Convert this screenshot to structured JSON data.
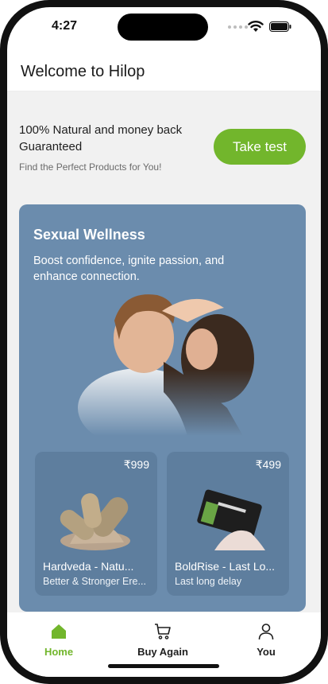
{
  "status_bar": {
    "time": "4:27"
  },
  "header": {
    "title": "Welcome to Hilop"
  },
  "promo": {
    "headline": "100% Natural and money back Guaranteed",
    "subtext": "Find the Perfect Products for You!",
    "cta_label": "Take test",
    "cta_color": "#72b62c"
  },
  "category_card": {
    "title": "Sexual Wellness",
    "description": "Boost confidence, ignite passion, and enhance connection.",
    "background_color": "#6b8cad",
    "products": [
      {
        "price": "₹999",
        "name": "Hardveda - Natu...",
        "description": "Better & Stronger Ere...",
        "image": "capsules-powder"
      },
      {
        "price": "₹499",
        "name": "BoldRise - Last Lo...",
        "description": "Last long delay",
        "image": "sachet-powder"
      }
    ]
  },
  "bottom_nav": {
    "items": [
      {
        "label": "Home",
        "icon": "home-icon",
        "active": true
      },
      {
        "label": "Buy Again",
        "icon": "cart-icon",
        "active": false
      },
      {
        "label": "You",
        "icon": "user-icon",
        "active": false
      }
    ]
  }
}
